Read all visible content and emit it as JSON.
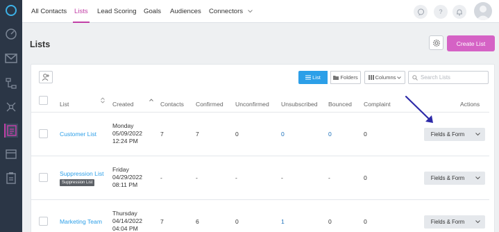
{
  "nav": {
    "tabs": [
      {
        "label": "All Contacts"
      },
      {
        "label": "Lists"
      },
      {
        "label": "Lead Scoring"
      },
      {
        "label": "Goals"
      },
      {
        "label": "Audiences"
      },
      {
        "label": "Connectors"
      }
    ],
    "active_tab": "Lists",
    "right_icons": [
      "chat-icon",
      "help-icon",
      "bell-icon",
      "avatar"
    ]
  },
  "sidebar": {
    "icons": [
      "activecampaign-logo",
      "dashboard-icon",
      "email-icon",
      "automations-icon",
      "deals-icon",
      "contacts-icon",
      "site-icon",
      "reports-icon"
    ],
    "active": "contacts-icon"
  },
  "page": {
    "title": "Lists",
    "create_button": "Create List"
  },
  "toolbar": {
    "view_list": "List",
    "view_folders": "Folders",
    "columns": "Columns",
    "search_placeholder": "Search Lists"
  },
  "table": {
    "headers": {
      "list": "List",
      "created": "Created",
      "contacts": "Contacts",
      "confirmed": "Confirmed",
      "unconfirmed": "Unconfirmed",
      "unsubscribed": "Unsubscribed",
      "bounced": "Bounced",
      "complaint": "Complaint",
      "actions": "Actions"
    },
    "rows": [
      {
        "name": "Customer List",
        "created_day": "Monday",
        "created_date": "05/09/2022",
        "created_time": "12:24 PM",
        "contacts": "7",
        "confirmed": "7",
        "unconfirmed": "0",
        "unsubscribed": "0",
        "bounced": "0",
        "complaint": "0",
        "action": "Fields & Form"
      },
      {
        "name": "Suppression List",
        "tag": "Suppression List",
        "created_day": "Friday",
        "created_date": "04/29/2022",
        "created_time": "08:11 PM",
        "contacts": "-",
        "confirmed": "-",
        "unconfirmed": "-",
        "unsubscribed": "-",
        "bounced": "-",
        "complaint": "0",
        "action": "Fields & Form"
      },
      {
        "name": "Marketing Team",
        "created_day": "Thursday",
        "created_date": "04/14/2022",
        "created_time": "04:04 PM",
        "contacts": "7",
        "confirmed": "6",
        "unconfirmed": "0",
        "unsubscribed": "1",
        "bounced": "0",
        "complaint": "0",
        "action": "Fields & Form"
      }
    ]
  },
  "colors": {
    "accent": "#c13fa6",
    "create_button": "#d562c5",
    "active_toggle": "#2c9fe8",
    "annotation_arrow": "#2d2aa8"
  }
}
